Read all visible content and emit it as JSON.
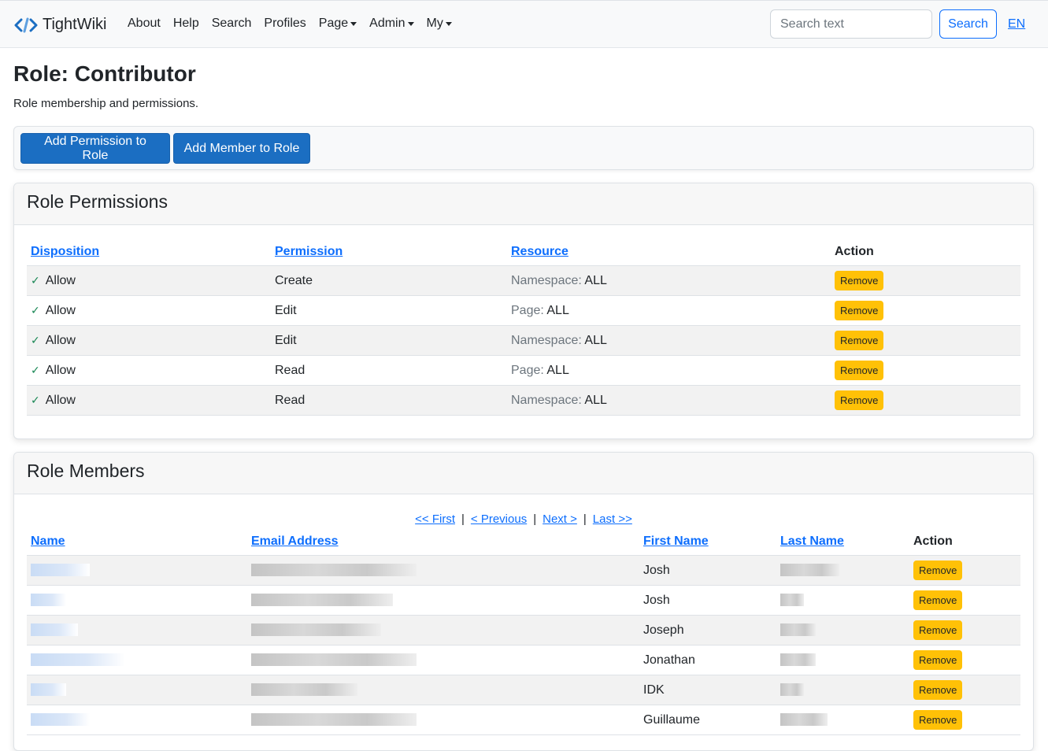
{
  "nav": {
    "brand": "TightWiki",
    "links": [
      {
        "label": "About",
        "dropdown": false
      },
      {
        "label": "Help",
        "dropdown": false
      },
      {
        "label": "Search",
        "dropdown": false
      },
      {
        "label": "Profiles",
        "dropdown": false
      },
      {
        "label": "Page",
        "dropdown": true
      },
      {
        "label": "Admin",
        "dropdown": true
      },
      {
        "label": "My",
        "dropdown": true
      }
    ],
    "search_placeholder": "Search text",
    "search_button": "Search",
    "language": "EN"
  },
  "page": {
    "title": "Role: Contributor",
    "subtitle": "Role membership and permissions."
  },
  "toolbar": {
    "add_permission": "Add Permission to Role",
    "add_member": "Add Member to Role"
  },
  "permissions": {
    "title": "Role Permissions",
    "columns": [
      "Disposition",
      "Permission",
      "Resource",
      "Action"
    ],
    "rows": [
      {
        "disposition": "Allow",
        "permission": "Create",
        "resource_type": "Namespace:",
        "resource_value": "ALL",
        "action": "Remove"
      },
      {
        "disposition": "Allow",
        "permission": "Edit",
        "resource_type": "Page:",
        "resource_value": "ALL",
        "action": "Remove"
      },
      {
        "disposition": "Allow",
        "permission": "Edit",
        "resource_type": "Namespace:",
        "resource_value": "ALL",
        "action": "Remove"
      },
      {
        "disposition": "Allow",
        "permission": "Read",
        "resource_type": "Page:",
        "resource_value": "ALL",
        "action": "Remove"
      },
      {
        "disposition": "Allow",
        "permission": "Read",
        "resource_type": "Namespace:",
        "resource_value": "ALL",
        "action": "Remove"
      }
    ]
  },
  "members": {
    "title": "Role Members",
    "pager": {
      "first": "<< First",
      "previous": "< Previous",
      "next": "Next >",
      "last": "Last >>"
    },
    "columns": [
      "Name",
      "Email Address",
      "First Name",
      "Last Name",
      "Action"
    ],
    "rows": [
      {
        "first_name": "Josh",
        "action": "Remove"
      },
      {
        "first_name": "Josh",
        "action": "Remove"
      },
      {
        "first_name": "Joseph",
        "action": "Remove"
      },
      {
        "first_name": "Jonathan",
        "action": "Remove"
      },
      {
        "first_name": "IDK",
        "action": "Remove"
      },
      {
        "first_name": "Guillaume",
        "action": "Remove"
      }
    ]
  },
  "colors": {
    "primary": "#1b6ec2",
    "link": "#0d6efd",
    "warning": "#ffc107",
    "success": "#198754"
  }
}
